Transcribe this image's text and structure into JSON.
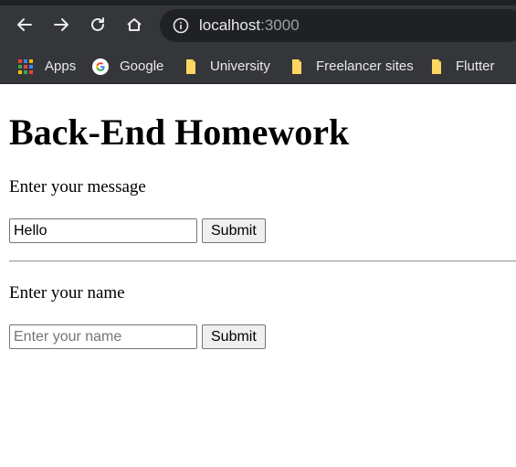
{
  "browser": {
    "address": {
      "host": "localhost",
      "port": ":3000"
    },
    "bookmarks": [
      {
        "label": "Apps",
        "icon": "apps-grid-icon"
      },
      {
        "label": "Google",
        "icon": "google-icon"
      },
      {
        "label": "University",
        "icon": "folder-icon"
      },
      {
        "label": "Freelancer sites",
        "icon": "folder-icon"
      },
      {
        "label": "Flutter",
        "icon": "folder-icon"
      }
    ],
    "colors": {
      "toolbar": "#35363a",
      "omnibox": "#202124",
      "folder": "#fdd663"
    }
  },
  "page": {
    "title": "Back-End Homework",
    "message_form": {
      "prompt": "Enter your message",
      "input_value": "Hello",
      "submit_label": "Submit"
    },
    "name_form": {
      "prompt": "Enter your name",
      "placeholder": "Enter your name",
      "submit_label": "Submit"
    }
  }
}
